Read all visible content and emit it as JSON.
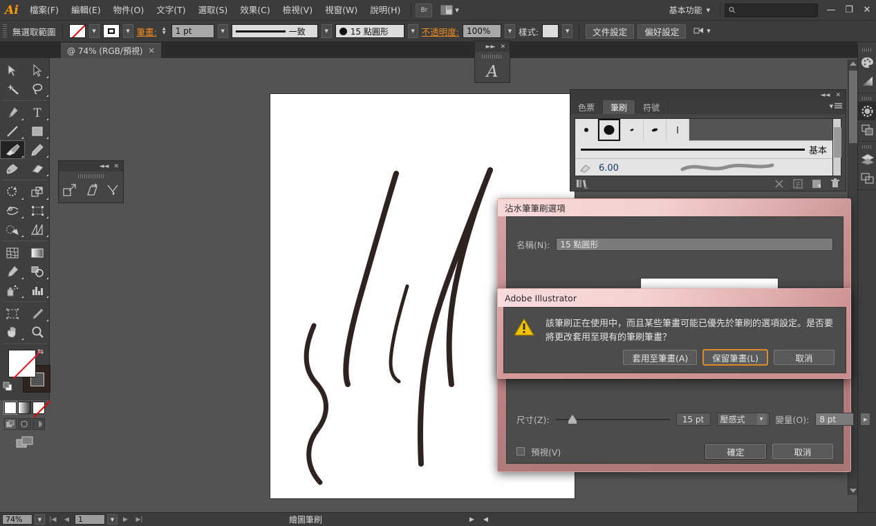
{
  "app": {
    "name": "Adobe Illustrator",
    "logo": "Ai"
  },
  "menubar": {
    "items": [
      "檔案(F)",
      "編輯(E)",
      "物件(O)",
      "文字(T)",
      "選取(S)",
      "效果(C)",
      "檢視(V)",
      "視窗(W)",
      "說明(H)"
    ],
    "bridge_label": "Br",
    "arrange_icon": "arrange-documents-icon",
    "workspace": "基本功能",
    "search_placeholder": "",
    "search_value": "",
    "minimize": "—",
    "restore": "❐",
    "close": "✕"
  },
  "controlbar": {
    "selection_status": "無選取範圍",
    "fill_label": "fill-swatch",
    "stroke_label": "stroke-swatch",
    "stroke_weight_label": "筆畫:",
    "stroke_weight_value": "1 pt",
    "profile_value": "一致",
    "brush_value": "15 點圓形",
    "opacity_label": "不透明度:",
    "opacity_value": "100%",
    "style_label": "樣式:",
    "document_setup": "文件設定",
    "preferences": "偏好設定"
  },
  "tabbar": {
    "doc_title": "@ 74% (RGB/預視)",
    "close": "✕"
  },
  "toolbar": {
    "tools": [
      "selection-tool",
      "direct-selection-tool",
      "magic-wand-tool",
      "lasso-tool",
      "pen-tool",
      "type-tool",
      "line-segment-tool",
      "rectangle-tool",
      "paintbrush-tool",
      "pencil-tool",
      "blob-brush-tool",
      "eraser-tool",
      "rotate-tool",
      "scale-tool",
      "width-tool",
      "free-transform-tool",
      "shape-builder-tool",
      "perspective-grid-tool",
      "mesh-tool",
      "gradient-tool",
      "eyedropper-tool",
      "blend-tool",
      "symbol-sprayer-tool",
      "column-graph-tool",
      "artboard-tool",
      "slice-tool",
      "hand-tool",
      "zoom-tool"
    ],
    "active_tool": "paintbrush-tool",
    "fill": "無",
    "stroke_color": "#2f2420"
  },
  "floating_tools_panel": {
    "icons": [
      "free-transform-icon",
      "shear-icon",
      "reshape-icon"
    ]
  },
  "floating_type_panel": {
    "glyph": "A"
  },
  "brushes_panel": {
    "tabs": [
      "色票",
      "筆刷",
      "符號"
    ],
    "active_tab": "筆刷",
    "thumbnails": [
      "brush-3pt-round",
      "brush-15pt-round",
      "brush-small-oval",
      "brush-flat-oval",
      "brush-thin-line"
    ],
    "selected_thumbnail_index": 1,
    "rows": [
      {
        "label": "基本",
        "type": "plain-line"
      },
      {
        "label": "6.00",
        "type": "art-stroke"
      }
    ],
    "footer_icons": [
      "brush-libraries-icon",
      "remove-brush-stroke-icon",
      "options-icon",
      "new-brush-icon",
      "delete-brush-icon"
    ]
  },
  "right_dock": {
    "icons": [
      "color-icon",
      "gradient-icon",
      "stroke-icon",
      "transparency-icon",
      "layers-icon",
      "artboards-icon"
    ]
  },
  "statusbar": {
    "zoom": "74%",
    "page": "1",
    "tool_name": "繪圖筆刷"
  },
  "brush_options_dialog": {
    "title": "沾水筆筆刷選項",
    "name_label": "名稱(N):",
    "name_value": "15 點圓形",
    "size_label": "尺寸(Z):",
    "size_value": "15 pt",
    "size_mode": "壓感式",
    "variation_label": "變量(O):",
    "variation_value": "8 pt",
    "preview_label": "預視(V)",
    "ok": "確定",
    "cancel": "取消"
  },
  "alert_dialog": {
    "title": "Adobe Illustrator",
    "icon": "warning-icon",
    "message": "該筆刷正在使用中，而且某些筆畫可能已優先於筆刷的選項設定。是否要將更改套用至現有的筆刷筆畫？",
    "buttons": [
      {
        "label": "套用至筆畫(A)",
        "focused": false
      },
      {
        "label": "保留筆畫(L)",
        "focused": true
      },
      {
        "label": "取消",
        "focused": false
      }
    ]
  },
  "artwork": {
    "stroke_color": "#2e2320",
    "description": "calligraphic-brush-strokes"
  }
}
